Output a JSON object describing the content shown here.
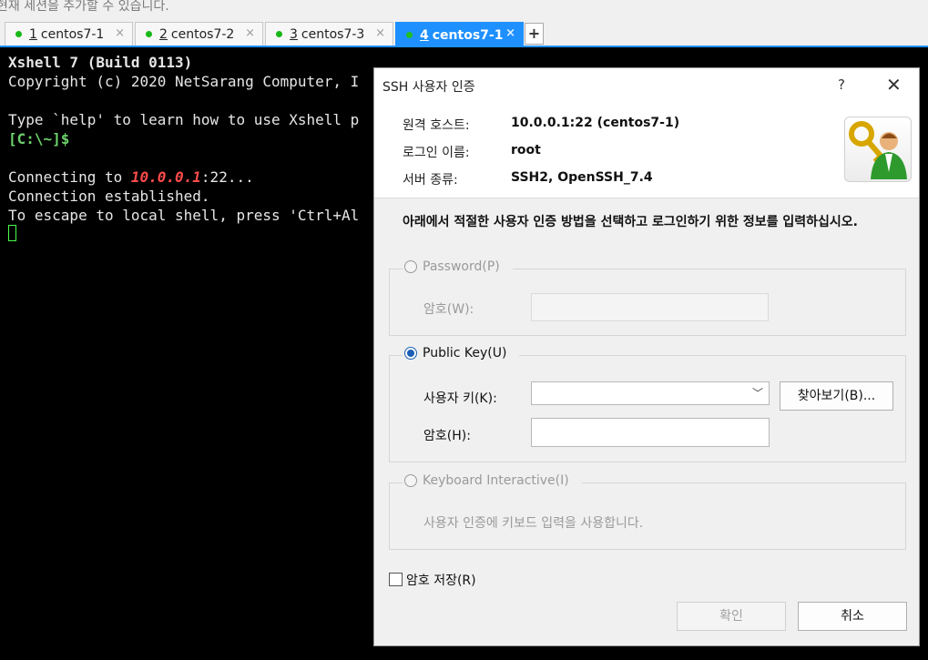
{
  "hint": "현재 세션을 추가할 수 있습니다.",
  "tabs": [
    {
      "num": "1",
      "name": "centos7-1",
      "close": "×"
    },
    {
      "num": "2",
      "name": "centos7-2",
      "close": "×"
    },
    {
      "num": "3",
      "name": "centos7-3",
      "close": "×"
    },
    {
      "num": "4",
      "name": "centos7-1",
      "close": "×"
    }
  ],
  "add_tab": "+",
  "terminal": {
    "line1": "Xshell 7 (Build 0113)",
    "line2": "Copyright (c) 2020 NetSarang Computer, I",
    "line3": "Type `help' to learn how to use Xshell p",
    "prompt": "[C:\\~]$",
    "connecting_prefix": "Connecting to ",
    "connecting_host": "10.0.0.1",
    "connecting_suffix": ":22...",
    "established": "Connection established.",
    "escape": "To escape to local shell, press 'Ctrl+Al"
  },
  "dialog": {
    "title": "SSH 사용자 인증",
    "help": "?",
    "close": "✕",
    "remote_host_label": "원격 호스트:",
    "remote_host_value": "10.0.0.1:22 (centos7-1)",
    "login_label": "로그인 이름:",
    "login_value": "root",
    "server_label": "서버 종류:",
    "server_value": "SSH2, OpenSSH_7.4",
    "instruction": "아래에서 적절한 사용자 인증 방법을 선택하고 로그인하기 위한 정보를 입력하십시오.",
    "password_group": {
      "label": "Password(P)",
      "field_label": "암호(W):"
    },
    "pubkey_group": {
      "label": "Public Key(U)",
      "key_label": "사용자 키(K):",
      "browse": "찾아보기(B)...",
      "pass_label": "암호(H):"
    },
    "keyboard_group": {
      "label": "Keyboard Interactive(I)",
      "desc": "사용자 인증에 키보드 입력을 사용합니다."
    },
    "save_password": "암호 저장(R)",
    "ok": "확인",
    "cancel": "취소"
  }
}
